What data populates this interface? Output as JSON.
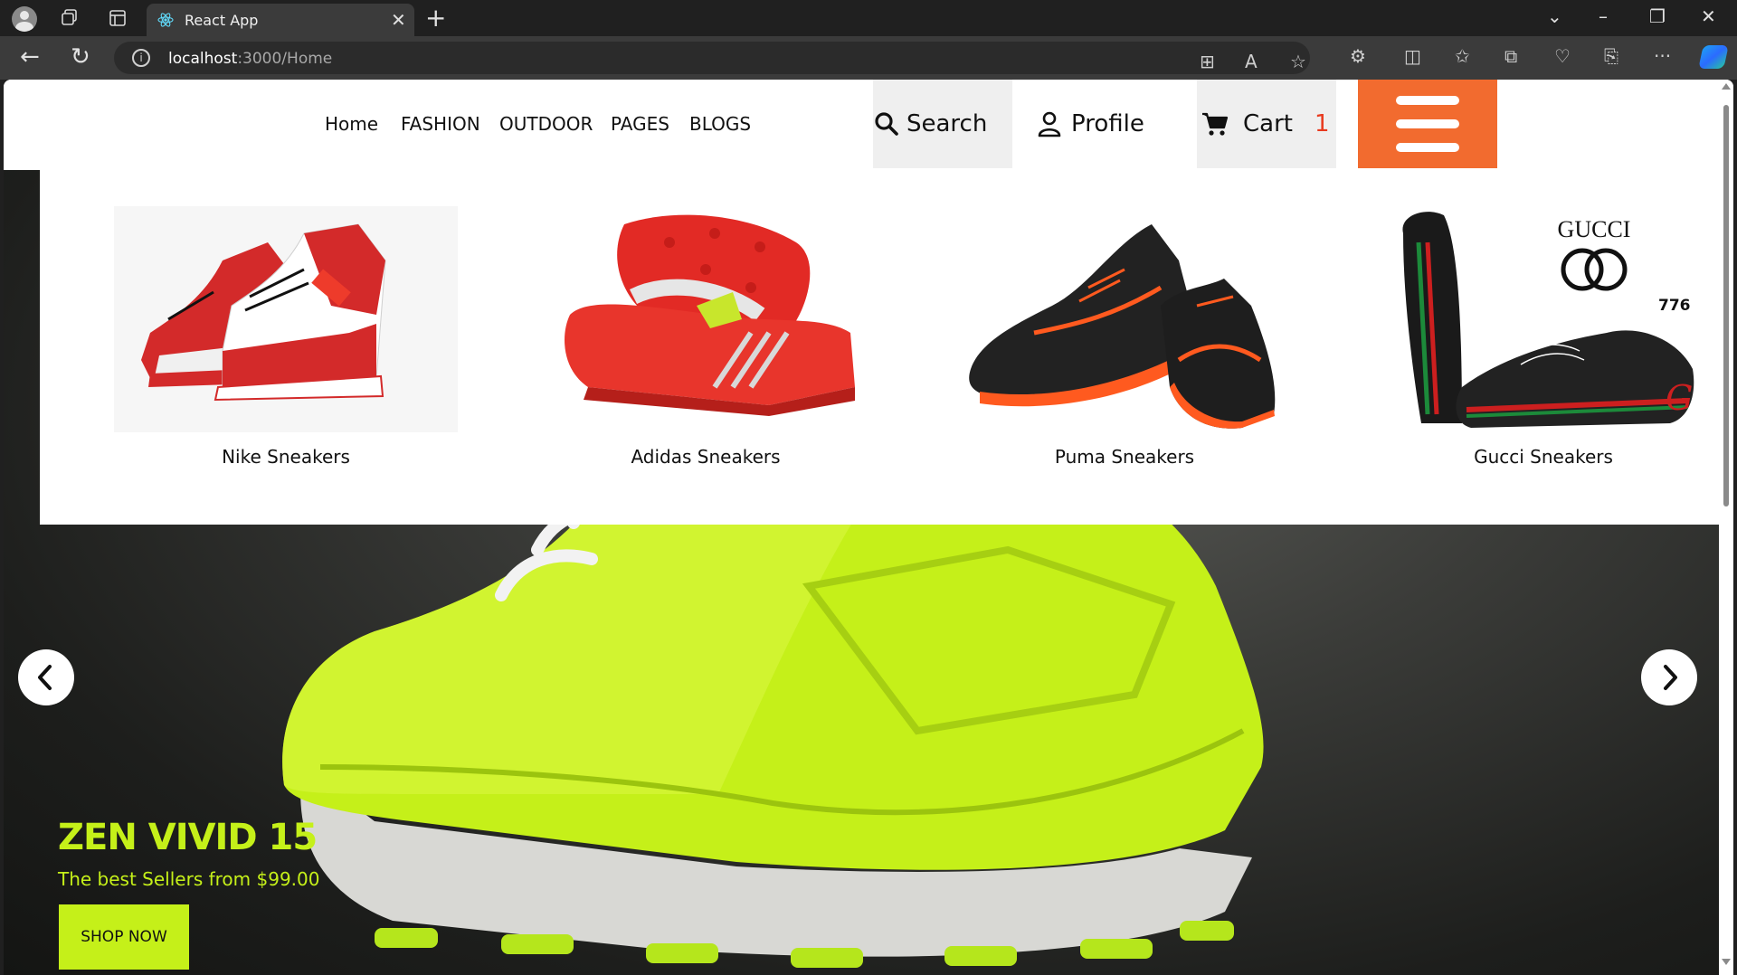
{
  "browser": {
    "tab_title": "React App",
    "tab_close": "✕",
    "new_tab": "+",
    "url_host": "localhost",
    "url_path": ":3000/Home"
  },
  "nav": {
    "links": [
      "Home",
      "FASHION",
      "OUTDOOR",
      "PAGES",
      "BLOGS"
    ],
    "search_label": "Search",
    "profile_label": "Profile",
    "cart_label": "Cart",
    "cart_count": "1"
  },
  "dropdown": {
    "products": [
      {
        "name": "Nike Sneakers"
      },
      {
        "name": "Adidas Sneakers"
      },
      {
        "name": "Puma Sneakers"
      },
      {
        "name": "Gucci Sneakers"
      }
    ],
    "gucci_logo_text": "GUCCI",
    "badge": "776"
  },
  "hero": {
    "title": "ZEN VIVID 15",
    "subtitle": "The best Sellers from $99.00",
    "cta": "SHOP NOW"
  },
  "colors": {
    "accent_orange": "#f26b2f",
    "hero_lime": "#c5f019",
    "cart_count_red": "#e83a1f"
  }
}
